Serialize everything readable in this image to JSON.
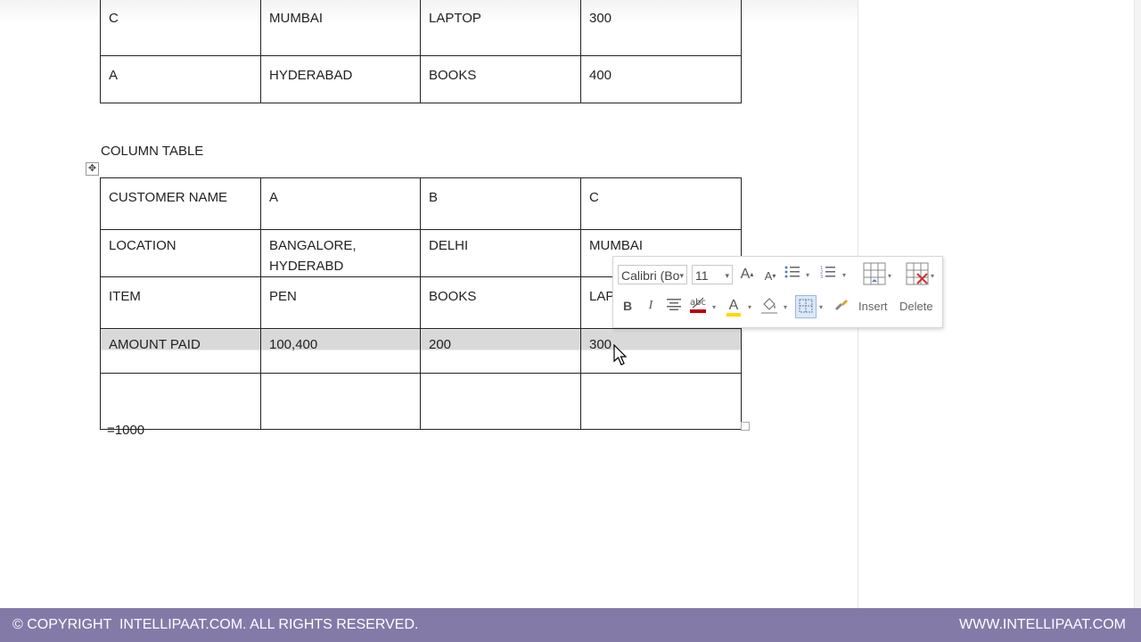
{
  "top_table": {
    "rows": [
      [
        "C",
        "MUMBAI",
        "LAPTOP",
        "300"
      ],
      [
        "A",
        "HYDERABAD",
        "BOOKS",
        "400"
      ]
    ]
  },
  "caption": "COLUMN TABLE",
  "main_table": {
    "rows": [
      [
        "CUSTOMER NAME",
        "A",
        "B",
        "C"
      ],
      [
        "LOCATION",
        "BANGALORE, HYDERABD",
        "DELHI",
        "MUMBAI"
      ],
      [
        "ITEM",
        "PEN",
        "BOOKS",
        "LAPTOP"
      ],
      [
        "AMOUNT PAID",
        "100,400",
        "200",
        "300"
      ],
      [
        "",
        "",
        "",
        ""
      ]
    ],
    "selected_row_index": 3
  },
  "formula_text": "=1000",
  "mini_toolbar": {
    "font_name": "Calibri (Bo",
    "font_size": "11",
    "grow_font_glyph": "A",
    "shrink_font_glyph": "A",
    "bold_glyph": "B",
    "italic_glyph": "I",
    "font_color_glyph": "A",
    "insert_label": "Insert",
    "delete_label": "Delete",
    "font_color": "#c00000",
    "highlight_color": "#ffd700"
  },
  "footer": {
    "left_text": "© COPYRIGHT  INTELLIPAAT.COM. ALL RIGHTS RESERVED.",
    "right_text": "WWW.INTELLIPAAT.COM",
    "bg_color": "#847aa8"
  }
}
